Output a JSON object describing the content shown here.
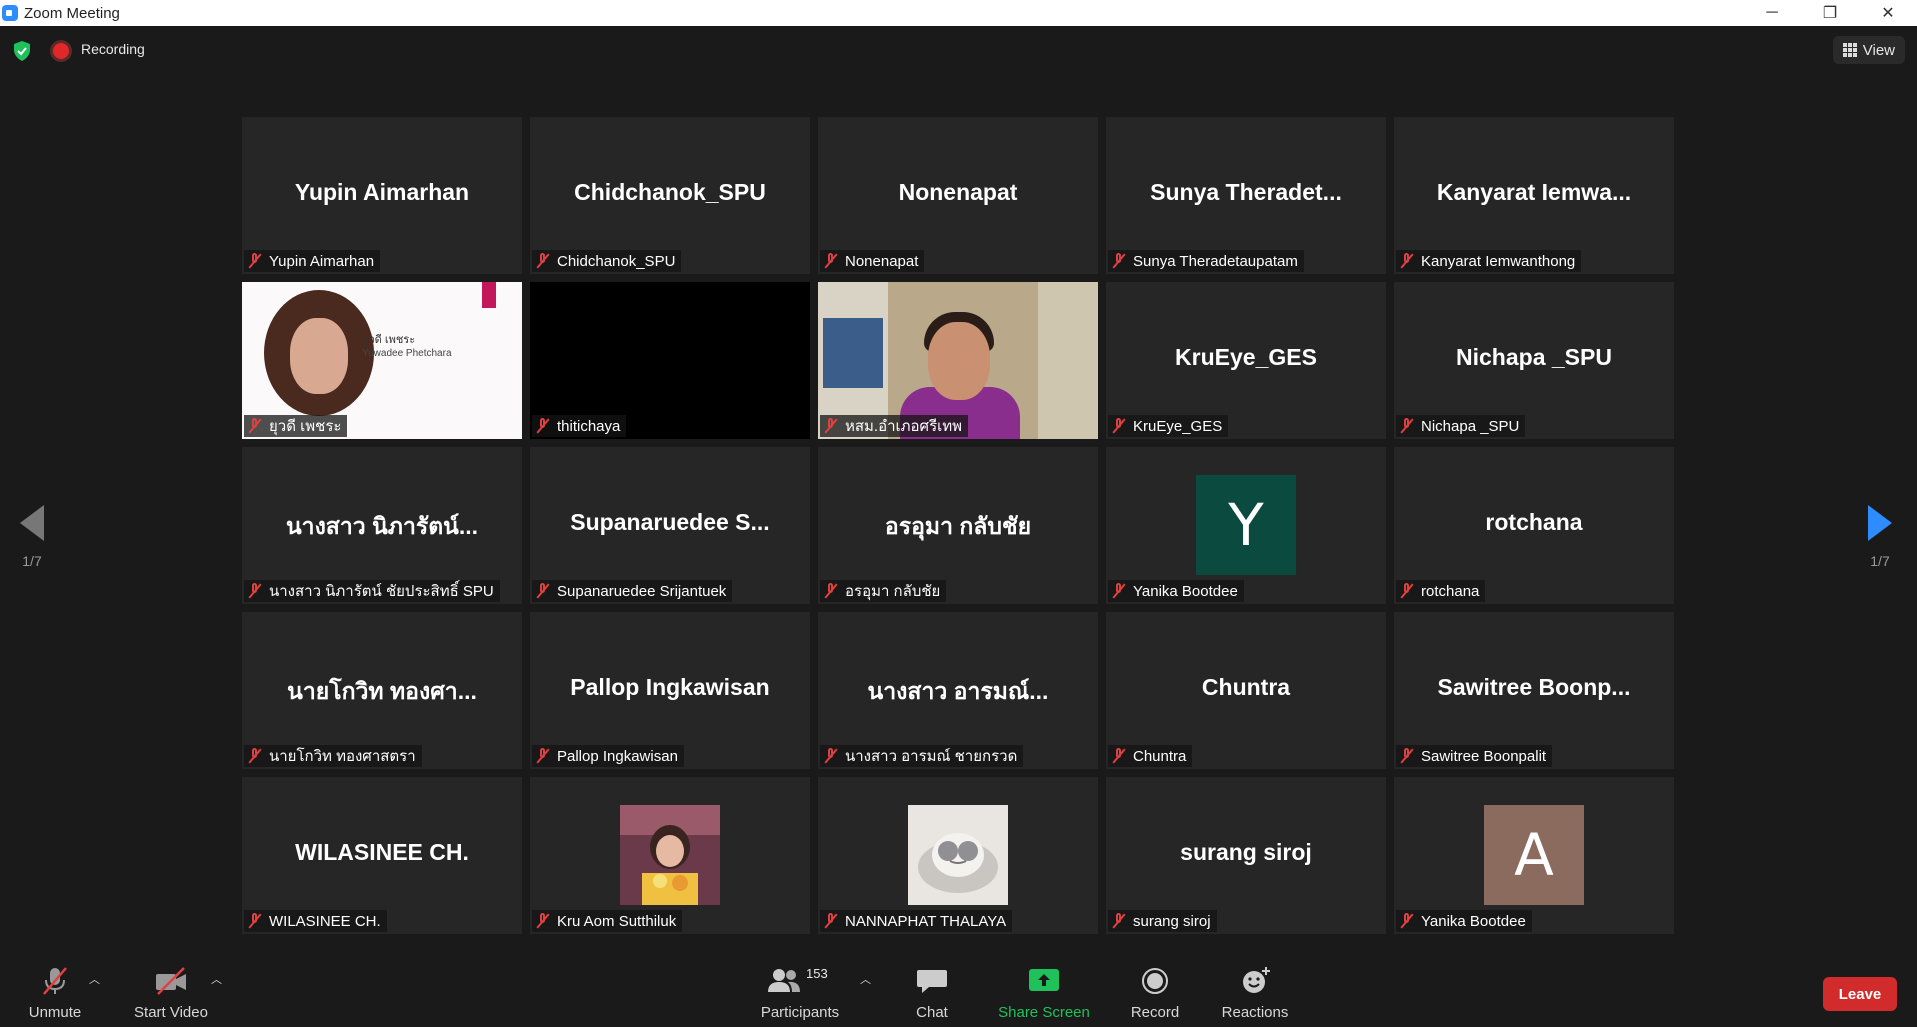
{
  "window": {
    "title": "Zoom Meeting",
    "min": "─",
    "max": "❐",
    "close": "✕"
  },
  "status": {
    "recording": "Recording",
    "view": "View"
  },
  "nav": {
    "left_page": "1/7",
    "right_page": "1/7"
  },
  "tiles": [
    {
      "big": "Yupin Aimarhan",
      "tag": "Yupin Aimarhan"
    },
    {
      "big": "Chidchanok_SPU",
      "tag": "Chidchanok_SPU"
    },
    {
      "big": "Nonenapat",
      "tag": "Nonenapat"
    },
    {
      "big": "Sunya Theradet...",
      "tag": "Sunya Theradetaupatam"
    },
    {
      "big": "Kanyarat Iemwa...",
      "tag": "Kanyarat Iemwanthong"
    },
    {
      "tag": "ยุวดี เพชระ",
      "card_th": "ยุวดี เพชระ",
      "card_en": "Yuwadee Phetchara"
    },
    {
      "tag": "thitichaya"
    },
    {
      "tag": "หสม.อำเภอศรีเทพ"
    },
    {
      "big": "KruEye_GES",
      "tag": "KruEye_GES"
    },
    {
      "big": "Nichapa _SPU",
      "tag": "Nichapa _SPU"
    },
    {
      "big": "นางสาว นิภารัตน์...",
      "tag": "นางสาว นิภารัตน์ ชัยประสิทธิ์ SPU"
    },
    {
      "big": "Supanaruedee S...",
      "tag": "Supanaruedee Srijantuek"
    },
    {
      "big": "อรอุมา กลับชัย",
      "tag": "อรอุมา กลับชัย"
    },
    {
      "avatar": "Y",
      "tag": "Yanika Bootdee"
    },
    {
      "big": "rotchana",
      "tag": "rotchana"
    },
    {
      "big": "นายโกวิท ทองศา...",
      "tag": "นายโกวิท ทองศาสตรา"
    },
    {
      "big": "Pallop Ingkawisan",
      "tag": "Pallop Ingkawisan"
    },
    {
      "big": "นางสาว อารมณ์...",
      "tag": "นางสาว อารมณ์ ชายกรวด"
    },
    {
      "big": "Chuntra",
      "tag": "Chuntra"
    },
    {
      "big": "Sawitree Boonp...",
      "tag": "Sawitree Boonpalit"
    },
    {
      "big": "WILASINEE CH.",
      "tag": "WILASINEE CH."
    },
    {
      "tag": "Kru Aom Sutthiluk"
    },
    {
      "tag": "NANNAPHAT THALAYA"
    },
    {
      "big": "surang siroj",
      "tag": "surang siroj"
    },
    {
      "avatar": "A",
      "tag": "Yanika Bootdee"
    }
  ],
  "toolbar": {
    "unmute": "Unmute",
    "start_video": "Start Video",
    "participants": "Participants",
    "participants_count": "153",
    "chat": "Chat",
    "share_screen": "Share Screen",
    "record": "Record",
    "reactions": "Reactions",
    "leave": "Leave"
  },
  "colors": {
    "share_green": "#1fc15a",
    "leave_red": "#d12b2b",
    "avatar_y": "#0b4a3e",
    "avatar_a": "#8b6b5e",
    "accent_blue": "#2d8cff"
  }
}
